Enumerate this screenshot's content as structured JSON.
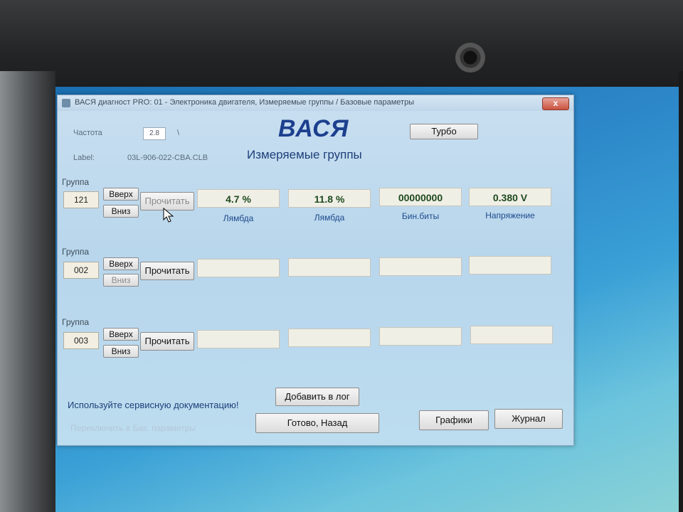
{
  "window": {
    "title": "ВАСЯ диагност PRO: 01 - Электроника двигателя, Измеряемые группы / Базовые параметры",
    "close_label": "x"
  },
  "header": {
    "freq_label": "Частота",
    "freq_value": "2.8",
    "freq_unit": "\\",
    "label_caption": "Label:",
    "label_value": "03L-906-022-CBA.CLB",
    "brand": "ВАСЯ",
    "subtitle": "Измеряемые группы",
    "turbo_button": "Турбо"
  },
  "groups": [
    {
      "label": "Группа",
      "number": "121",
      "up_label": "Вверх",
      "down_label": "Вниз",
      "read_label": "Прочитать",
      "values": [
        "4.7 %",
        "11.8 %",
        "00000000",
        "0.380 V"
      ],
      "captions": [
        "Лямбда",
        "Лямбда",
        "Бин.биты",
        "Напряжение"
      ]
    },
    {
      "label": "Группа",
      "number": "002",
      "up_label": "Вверх",
      "down_label": "Вниз",
      "read_label": "Прочитать",
      "values": [
        "",
        "",
        "",
        ""
      ],
      "captions": [
        "",
        "",
        "",
        ""
      ]
    },
    {
      "label": "Группа",
      "number": "003",
      "up_label": "Вверх",
      "down_label": "Вниз",
      "read_label": "Прочитать",
      "values": [
        "",
        "",
        "",
        ""
      ],
      "captions": [
        "",
        "",
        "",
        ""
      ]
    }
  ],
  "footer": {
    "service_note": "Используйте сервисную документацию!",
    "add_log_button": "Добавить в лог",
    "switch_basic_label": "Переключить в Баз. параметры",
    "done_back_button": "Готово, Назад",
    "charts_button": "Графики",
    "journal_button": "Журнал"
  }
}
